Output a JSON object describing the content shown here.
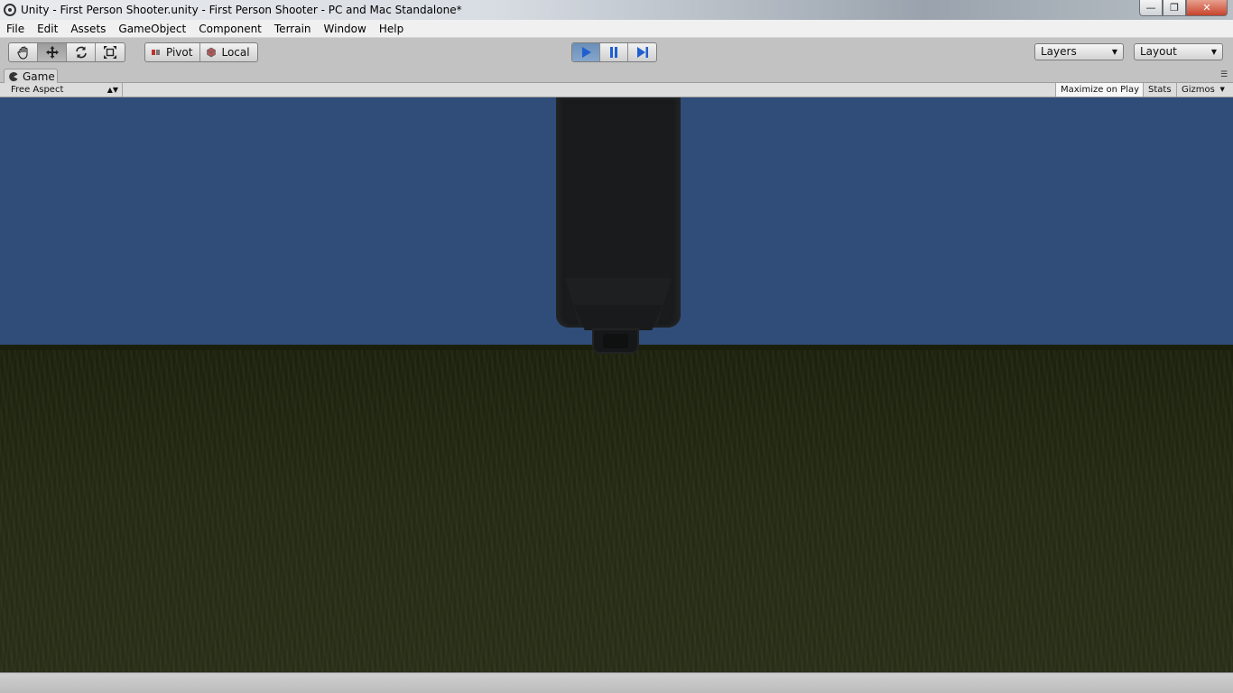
{
  "window": {
    "title": "Unity - First Person Shooter.unity - First Person Shooter - PC and Mac Standalone*",
    "controls": {
      "minimize": "—",
      "restore": "❐",
      "close": "✕"
    }
  },
  "menubar": {
    "items": [
      {
        "label": "File"
      },
      {
        "label": "Edit"
      },
      {
        "label": "Assets"
      },
      {
        "label": "GameObject"
      },
      {
        "label": "Component"
      },
      {
        "label": "Terrain"
      },
      {
        "label": "Window"
      },
      {
        "label": "Help"
      }
    ]
  },
  "toolbar": {
    "transform_tools": [
      "hand-icon",
      "move-icon",
      "rotate-icon",
      "scale-icon"
    ],
    "active_tool": "move-icon",
    "pivot_label": "Pivot",
    "local_label": "Local",
    "play_controls": [
      "play-icon",
      "pause-icon",
      "step-icon"
    ],
    "playing": true,
    "layers_label": "Layers",
    "layout_label": "Layout"
  },
  "game_panel": {
    "tab_label": "Game",
    "aspect_label": "Free Aspect",
    "maximize_label": "Maximize on Play",
    "stats_label": "Stats",
    "gizmos_label": "Gizmos",
    "maximize_on": true
  },
  "colors": {
    "sky": "#304d79",
    "ground": "#262d15",
    "play_active": "#6a8fb8",
    "editor_bg": "#c2c2c2"
  }
}
